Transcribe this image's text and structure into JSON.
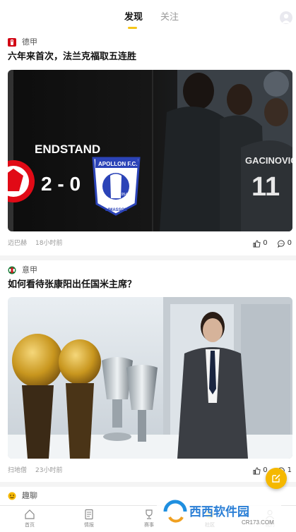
{
  "header": {
    "tabs": [
      {
        "label": "发现",
        "active": true
      },
      {
        "label": "关注",
        "active": false
      }
    ]
  },
  "posts": [
    {
      "league": "德甲",
      "title": "六年来首次，法兰克福取五连胜",
      "image": {
        "scoreboard_text": "ENDSTAND",
        "score": "2 - 0",
        "away_badge_text": "APOLLON F.C.",
        "away_badge_year": "1954",
        "away_badge_city": "LIMASSOL",
        "jersey_name": "GACINOVIĆ",
        "jersey_number": "11"
      },
      "author": "迈巴赫",
      "time": "18小时前",
      "likes": "0",
      "comments": "0"
    },
    {
      "league": "意甲",
      "title": "如何看待张康阳出任国米主席？",
      "author": "扫地僧",
      "time": "23小时前",
      "likes": "0",
      "comments": "1"
    },
    {
      "league": "趣聊"
    }
  ],
  "bottom_nav": {
    "items": [
      {
        "label": "首页",
        "icon": "home-icon",
        "active": false
      },
      {
        "label": "情报",
        "icon": "document-icon",
        "active": false
      },
      {
        "label": "赛事",
        "icon": "trophy-icon",
        "active": false
      },
      {
        "label": "社区",
        "icon": "community-icon",
        "active": true
      },
      {
        "label": "我的",
        "icon": "profile-icon",
        "active": false
      }
    ]
  },
  "watermark": {
    "text": "西西软件园",
    "url": "CR173.COM"
  },
  "colors": {
    "accent": "#f5c518",
    "fab": "#f5b800",
    "text": "#111111",
    "muted": "#999999"
  }
}
